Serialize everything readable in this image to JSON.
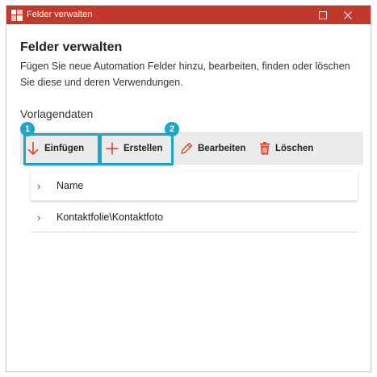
{
  "window": {
    "title": "Felder verwalten",
    "maximize_icon": "maximize-icon",
    "close_icon": "close-icon",
    "app_icon": "app-logo-icon"
  },
  "dialog": {
    "heading": "Felder verwalten",
    "description": "Fügen Sie neue Automation Felder hinzu, bearbeiten, finden oder löschen Sie diese und deren Verwendungen."
  },
  "section": {
    "title": "Vorlagendaten"
  },
  "toolbar": {
    "insert_label": "Einfügen",
    "create_label": "Erstellen",
    "edit_label": "Bearbeiten",
    "delete_label": "Löschen"
  },
  "callouts": {
    "badge_1": "1",
    "badge_2": "2",
    "color": "#1aa7c9"
  },
  "tree": {
    "items": [
      {
        "label": "Name"
      },
      {
        "label": "Kontaktfolie\\Kontaktfoto"
      }
    ]
  },
  "colors": {
    "titlebar": "#c0392b",
    "accent_red": "#d9472b",
    "toolbar_bg": "#ebebeb"
  }
}
